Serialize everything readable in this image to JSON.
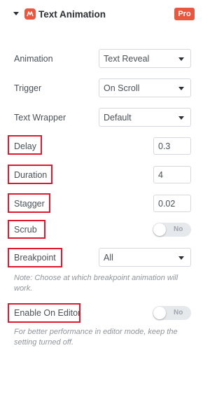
{
  "header": {
    "title": "Text Animation",
    "badge": "Pro",
    "icon": "widget-icon",
    "accent": "#e9573f"
  },
  "controls": {
    "animation": {
      "label": "Animation",
      "value": "Text Reveal"
    },
    "trigger": {
      "label": "Trigger",
      "value": "On Scroll"
    },
    "text_wrapper": {
      "label": "Text Wrapper",
      "value": "Default"
    },
    "delay": {
      "label": "Delay",
      "value": "0.3"
    },
    "duration": {
      "label": "Duration",
      "value": "4"
    },
    "stagger": {
      "label": "Stagger",
      "value": "0.02"
    },
    "scrub": {
      "label": "Scrub",
      "toggle_text": "No",
      "enabled": false
    },
    "breakpoint": {
      "label": "Breakpoint",
      "value": "All",
      "note": "Note: Choose at which breakpoint animation will work."
    },
    "enable_on_editor": {
      "label": "Enable On Editor",
      "toggle_text": "No",
      "enabled": false,
      "note": "For better performance in editor mode, keep the setting turned off."
    }
  },
  "highlight_color": "#e0182d"
}
